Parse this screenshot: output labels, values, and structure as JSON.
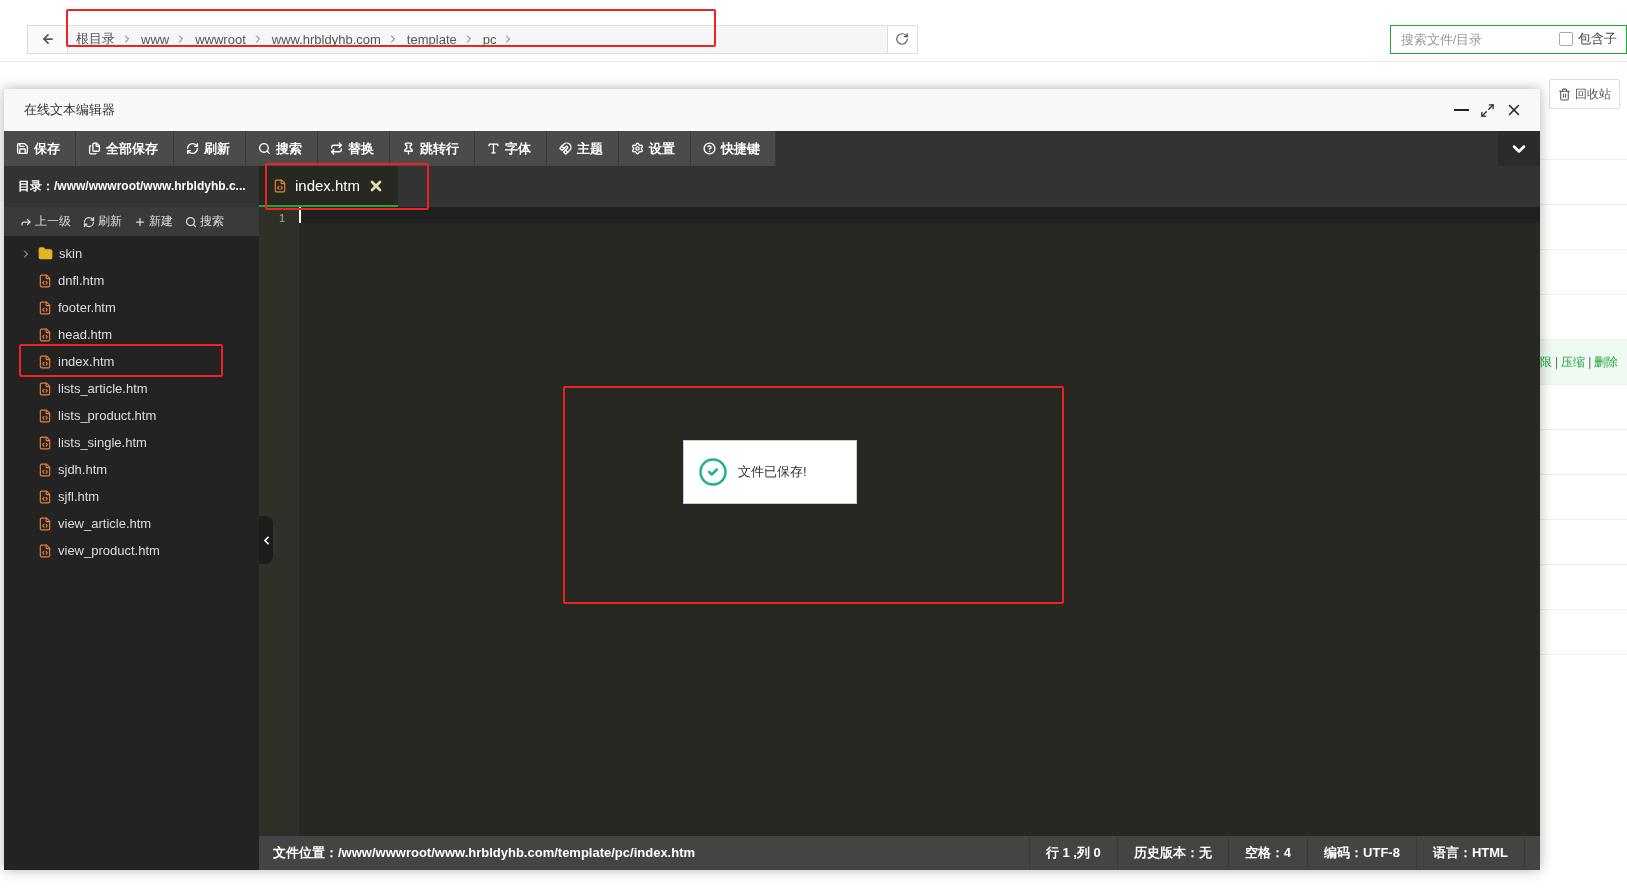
{
  "breadcrumb": {
    "items": [
      "根目录",
      "www",
      "wwwroot",
      "www.hrbldyhb.com",
      "template",
      "pc"
    ]
  },
  "search": {
    "placeholder": "搜索文件/目录",
    "include_label": "包含子",
    "include_checked": false
  },
  "recycle_button": "回收站",
  "row_actions": [
    {
      "kind": "link",
      "label": "限"
    },
    {
      "kind": "separator",
      "label": "|"
    },
    {
      "kind": "link",
      "label": "压缩"
    },
    {
      "kind": "separator",
      "label": "|"
    },
    {
      "kind": "link",
      "label": "删除"
    }
  ],
  "editor": {
    "title": "在线文本编辑器",
    "toolbar": [
      "保存",
      "全部保存",
      "刷新",
      "搜索",
      "替换",
      "跳转行",
      "字体",
      "主题",
      "设置",
      "快捷键"
    ],
    "directory": "目录：/www/wwwroot/www.hrbldyhb.c...",
    "tabs": [
      {
        "label": "index.htm",
        "selected": true
      }
    ],
    "sidebar_actions": [
      "上一级",
      "刷新",
      "新建",
      "搜索"
    ],
    "files": [
      {
        "name": "skin",
        "kind": "folder",
        "expanded": false
      },
      {
        "name": "dnfl.htm",
        "kind": "file"
      },
      {
        "name": "footer.htm",
        "kind": "file"
      },
      {
        "name": "head.htm",
        "kind": "file"
      },
      {
        "name": "index.htm",
        "kind": "file"
      },
      {
        "name": "lists_article.htm",
        "kind": "file"
      },
      {
        "name": "lists_product.htm",
        "kind": "file"
      },
      {
        "name": "lists_single.htm",
        "kind": "file"
      },
      {
        "name": "sjdh.htm",
        "kind": "file"
      },
      {
        "name": "sjfl.htm",
        "kind": "file"
      },
      {
        "name": "view_article.htm",
        "kind": "file"
      },
      {
        "name": "view_product.htm",
        "kind": "file"
      }
    ],
    "line_numbers": [
      "1"
    ],
    "toast": "文件已保存!",
    "status": {
      "path": "文件位置：/www/wwwroot/www.hrbldyhb.com/template/pc/index.htm",
      "items": [
        "行 1 ,列 0",
        "历史版本：无",
        "空格：4",
        "编码：UTF-8",
        "语言：HTML"
      ]
    }
  }
}
